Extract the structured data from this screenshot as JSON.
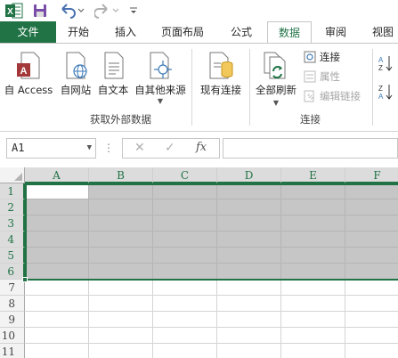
{
  "app": {
    "name": "Excel",
    "accent": "#217346",
    "selection_fill": "#c6c6c6"
  },
  "quick_access": {
    "icons": [
      "excel-logo-icon",
      "save-icon",
      "undo-icon",
      "redo-icon",
      "customize-qat-icon"
    ]
  },
  "tabs": [
    {
      "label": "文件"
    },
    {
      "label": "开始"
    },
    {
      "label": "插入"
    },
    {
      "label": "页面布局"
    },
    {
      "label": "公式"
    },
    {
      "label": "数据"
    },
    {
      "label": "审阅"
    },
    {
      "label": "视图"
    }
  ],
  "active_tab": "数据",
  "ribbon": {
    "get_external": {
      "buttons": [
        {
          "label": "自 Access",
          "icon": "access-icon"
        },
        {
          "label": "自网站",
          "icon": "web-icon"
        },
        {
          "label": "自文本",
          "icon": "text-file-icon"
        },
        {
          "label": "自其他来源",
          "icon": "other-sources-icon"
        }
      ],
      "existing": {
        "label": "现有连接",
        "icon": "existing-connections-icon"
      },
      "group_label": "获取外部数据"
    },
    "connections": {
      "refresh_all": {
        "label": "全部刷新",
        "icon": "refresh-all-icon"
      },
      "items": [
        {
          "label": "连接",
          "icon": "connections-icon",
          "enabled": true
        },
        {
          "label": "属性",
          "icon": "properties-icon",
          "enabled": false
        },
        {
          "label": "编辑链接",
          "icon": "edit-links-icon",
          "enabled": false
        }
      ],
      "group_label": "连接"
    },
    "sort": {
      "icons": [
        "sort-asc-icon",
        "sort-desc-icon"
      ]
    }
  },
  "formula_bar": {
    "name_box": "A1",
    "dots": "⋮",
    "cancel": "✕",
    "enter": "✓",
    "fx": "fx",
    "formula": ""
  },
  "grid": {
    "columns": [
      "A",
      "B",
      "C",
      "D",
      "E",
      "F"
    ],
    "rows": [
      "1",
      "2",
      "3",
      "4",
      "5",
      "6",
      "7",
      "8",
      "9",
      "10",
      "11"
    ],
    "selected_range": "A1:F6",
    "active_cell": "A1"
  }
}
